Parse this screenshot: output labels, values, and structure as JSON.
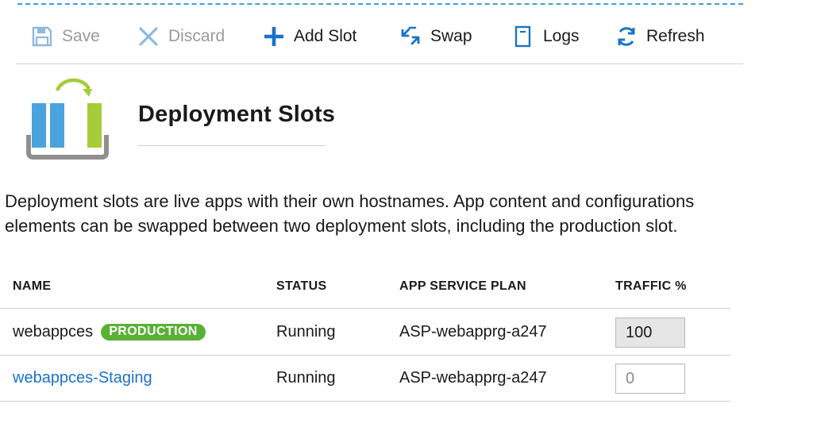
{
  "toolbar": {
    "save": "Save",
    "discard": "Discard",
    "add_slot": "Add Slot",
    "swap": "Swap",
    "logs": "Logs",
    "refresh": "Refresh"
  },
  "page": {
    "title": "Deployment Slots",
    "description_line1": "Deployment slots are live apps with their own hostnames. App content and configurations",
    "description_line2": "elements  can be swapped between two deployment slots, including the production slot."
  },
  "table": {
    "headers": {
      "name": "NAME",
      "status": "STATUS",
      "plan": "APP SERVICE PLAN",
      "traffic": "TRAFFIC %"
    },
    "rows": [
      {
        "name": "webappces",
        "badge": "PRODUCTION",
        "status": "Running",
        "plan": "ASP-webapprg-a247",
        "traffic": "100",
        "traffic_placeholder": ""
      },
      {
        "name": "webappces-Staging",
        "badge": "",
        "status": "Running",
        "plan": "ASP-webapprg-a247",
        "traffic": "",
        "traffic_placeholder": "0"
      }
    ]
  },
  "colors": {
    "accent_blue": "#1a73c8",
    "badge_green": "#58b134",
    "icon_blue": "#4aa3dd",
    "icon_green": "#a6cc3a"
  },
  "icons": {
    "save": "save-icon",
    "discard": "discard-x-icon",
    "add_slot": "plus-icon",
    "swap": "swap-arrows-icon",
    "logs": "logs-document-icon",
    "refresh": "refresh-icon",
    "hero": "deployment-slots-icon"
  }
}
